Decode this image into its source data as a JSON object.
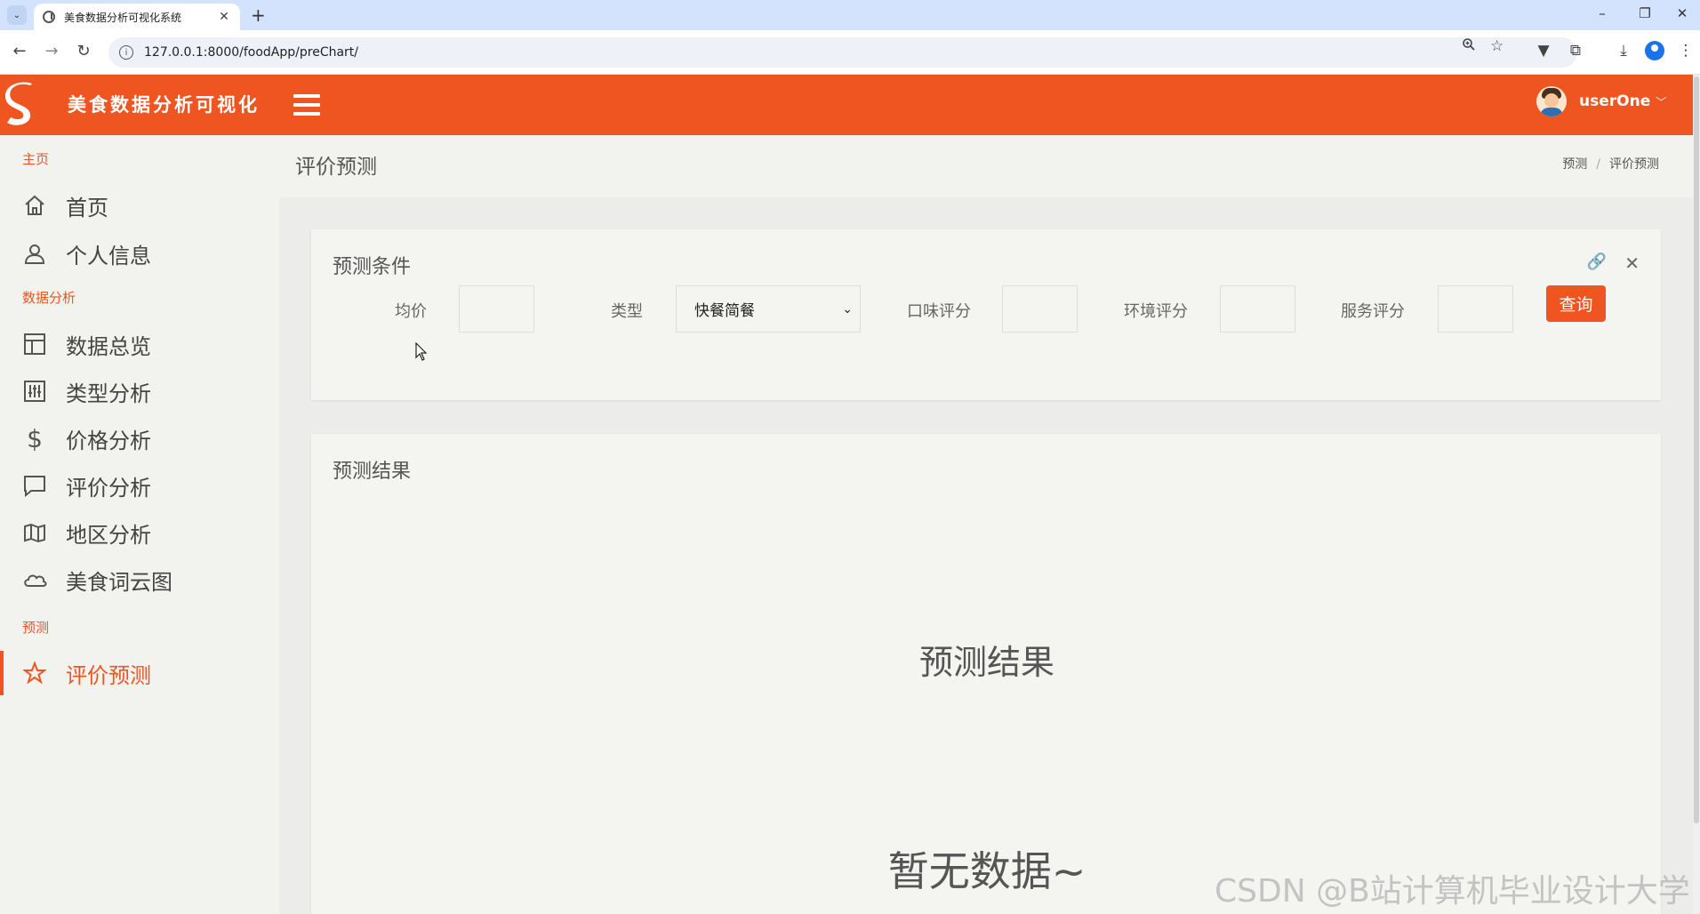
{
  "browser": {
    "tab_title": "美食数据分析可视化系统",
    "tab_close": "✕",
    "new_tab": "+",
    "url": "127.0.0.1:8000/foodApp/preChart/",
    "win_minimize": "–",
    "win_restore": "❐",
    "win_close": "✕"
  },
  "header": {
    "brand": "美食数据分析可视化",
    "user_name": "userOne",
    "brand_color": "#ef5521"
  },
  "sidebar": {
    "sections": [
      {
        "title": "主页",
        "items": [
          {
            "label": "首页",
            "icon": "home-icon"
          },
          {
            "label": "个人信息",
            "icon": "user-icon"
          }
        ]
      },
      {
        "title": "数据分析",
        "items": [
          {
            "label": "数据总览",
            "icon": "layout-icon"
          },
          {
            "label": "类型分析",
            "icon": "sliders-icon"
          },
          {
            "label": "价格分析",
            "icon": "dollar-icon"
          },
          {
            "label": "评价分析",
            "icon": "comment-icon"
          },
          {
            "label": "地区分析",
            "icon": "map-icon"
          },
          {
            "label": "美食词云图",
            "icon": "cloud-icon"
          }
        ]
      },
      {
        "title": "预测",
        "items": [
          {
            "label": "评价预测",
            "icon": "star-icon",
            "active": true
          }
        ]
      }
    ]
  },
  "page": {
    "title": "评价预测",
    "breadcrumb": [
      "预测",
      "评价预测"
    ]
  },
  "form_card": {
    "title": "预测条件",
    "fields": {
      "price_label": "均价",
      "type_label": "类型",
      "type_value": "快餐简餐",
      "taste_label": "口味评分",
      "env_label": "环境评分",
      "service_label": "服务评分"
    },
    "query_button": "查询"
  },
  "result_card": {
    "title": "预测结果",
    "heading": "预测结果",
    "empty_text": "暂无数据~"
  },
  "watermark": "CSDN @B站计算机毕业设计大学"
}
